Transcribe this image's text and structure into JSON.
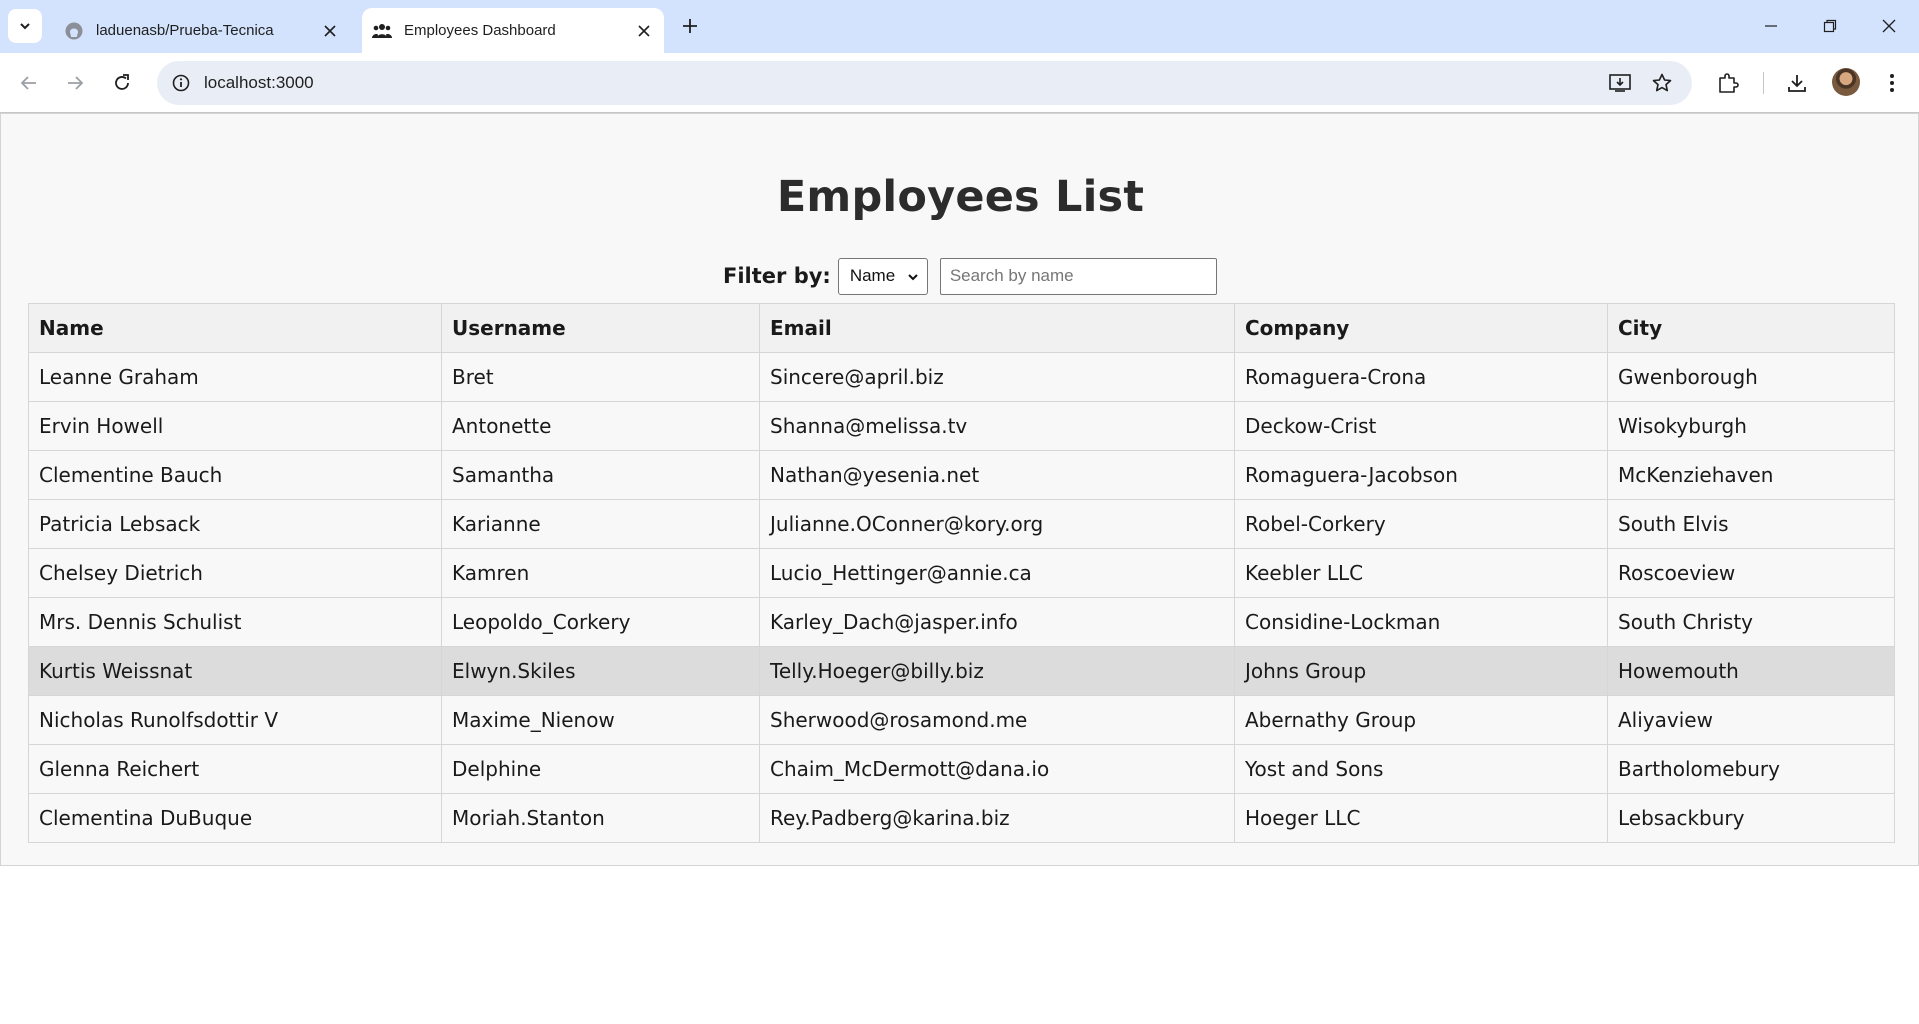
{
  "browser": {
    "tabs": [
      {
        "title": "laduenasb/Prueba-Tecnica",
        "favicon": "github-icon",
        "active": false
      },
      {
        "title": "Employees Dashboard",
        "favicon": "people-icon",
        "active": true
      }
    ],
    "url": "localhost:3000"
  },
  "page": {
    "title": "Employees List",
    "filter": {
      "label": "Filter by:",
      "selected_option": "Name",
      "search_placeholder": "Search by name",
      "search_value": ""
    },
    "table": {
      "columns": [
        "Name",
        "Username",
        "Email",
        "Company",
        "City"
      ],
      "rows": [
        [
          "Leanne Graham",
          "Bret",
          "Sincere@april.biz",
          "Romaguera-Crona",
          "Gwenborough"
        ],
        [
          "Ervin Howell",
          "Antonette",
          "Shanna@melissa.tv",
          "Deckow-Crist",
          "Wisokyburgh"
        ],
        [
          "Clementine Bauch",
          "Samantha",
          "Nathan@yesenia.net",
          "Romaguera-Jacobson",
          "McKenziehaven"
        ],
        [
          "Patricia Lebsack",
          "Karianne",
          "Julianne.OConner@kory.org",
          "Robel-Corkery",
          "South Elvis"
        ],
        [
          "Chelsey Dietrich",
          "Kamren",
          "Lucio_Hettinger@annie.ca",
          "Keebler LLC",
          "Roscoeview"
        ],
        [
          "Mrs. Dennis Schulist",
          "Leopoldo_Corkery",
          "Karley_Dach@jasper.info",
          "Considine-Lockman",
          "South Christy"
        ],
        [
          "Kurtis Weissnat",
          "Elwyn.Skiles",
          "Telly.Hoeger@billy.biz",
          "Johns Group",
          "Howemouth"
        ],
        [
          "Nicholas Runolfsdottir V",
          "Maxime_Nienow",
          "Sherwood@rosamond.me",
          "Abernathy Group",
          "Aliyaview"
        ],
        [
          "Glenna Reichert",
          "Delphine",
          "Chaim_McDermott@dana.io",
          "Yost and Sons",
          "Bartholomebury"
        ],
        [
          "Clementina DuBuque",
          "Moriah.Stanton",
          "Rey.Padberg@karina.biz",
          "Hoeger LLC",
          "Lebsackbury"
        ]
      ],
      "highlighted_row": 6
    }
  },
  "colors": {
    "tabstrip": "#d3e3fd",
    "omnibox": "#e9eef6",
    "page_background": "#f8f8f8",
    "header_background": "#f1f1f1",
    "highlight_row": "#dcdcdc"
  }
}
